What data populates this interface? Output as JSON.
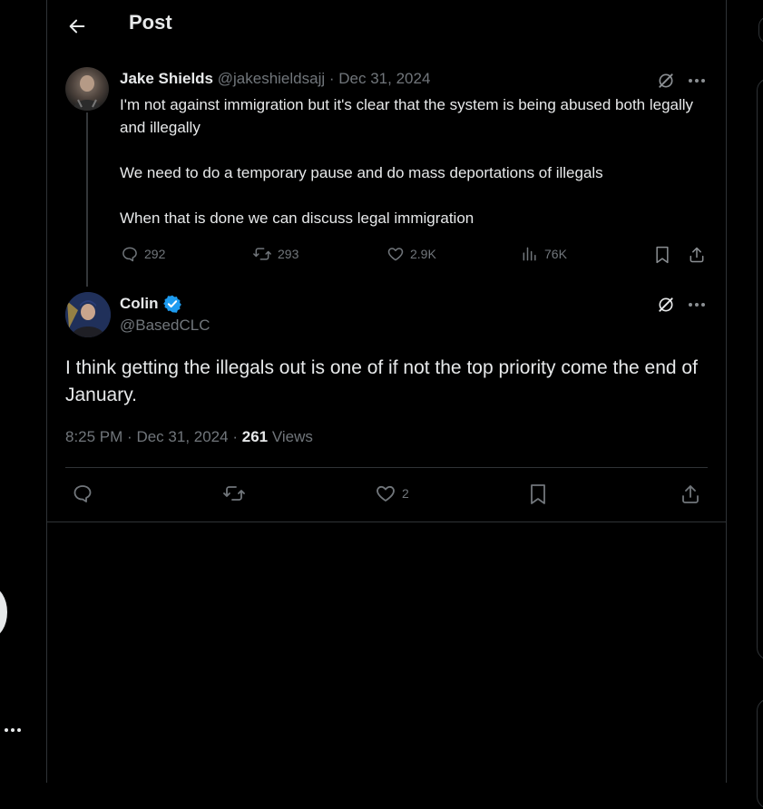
{
  "header": {
    "title": "Post",
    "back_icon": "arrow-left-icon"
  },
  "parent_tweet": {
    "author_name": "Jake Shields",
    "handle": "@jakeshieldsajj",
    "separator": "·",
    "date": "Dec 31, 2024",
    "text": "I'm not against immigration but it's clear that the system is being abused both legally and illegally\n\nWe need to do a temporary pause and do mass deportations of illegals\n\nWhen that is done we can discuss legal immigration",
    "replies": "292",
    "reposts": "293",
    "likes": "2.9K",
    "views": "76K"
  },
  "main_tweet": {
    "author_name": "Colin",
    "verified": true,
    "handle": "@BasedCLC",
    "text": "I think getting the illegals out is one of if not the top priority come the end of January.",
    "time": "8:25 PM",
    "separator": "·",
    "date": "Dec 31, 2024",
    "views_count": "261",
    "views_label": "Views",
    "likes": "2"
  },
  "sidebar": {
    "more_icon": "more-dots-icon"
  },
  "colors": {
    "accent": "#1d9bf0",
    "background": "#000000",
    "text": "#e7e9ea",
    "muted": "#71767b",
    "border": "#2f3336"
  }
}
